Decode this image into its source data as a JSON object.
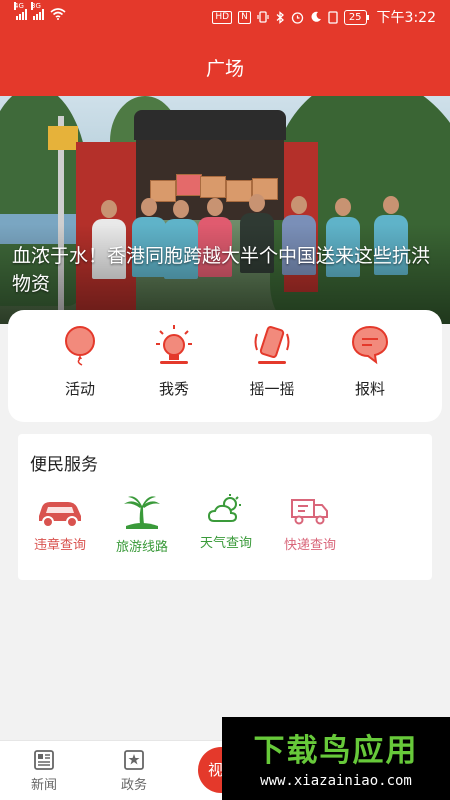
{
  "status_bar": {
    "signal_1_tag": "4G",
    "signal_2_tag": "3G",
    "hd_badge": "HD",
    "nfc_badge": "N",
    "battery": "25",
    "time": "下午3:22"
  },
  "header": {
    "title": "广场"
  },
  "banner": {
    "caption": "血浓于水！香港同胞跨越大半个中国送来这些抗洪物资"
  },
  "quick_actions": [
    {
      "label": "活动",
      "icon": "balloon-icon"
    },
    {
      "label": "我秀",
      "icon": "bulb-icon"
    },
    {
      "label": "摇一摇",
      "icon": "shake-phone-icon"
    },
    {
      "label": "报料",
      "icon": "chat-bubble-icon"
    }
  ],
  "services": {
    "title": "便民服务",
    "items": [
      {
        "label": "违章查询",
        "icon": "car-icon",
        "color": "#d9534f"
      },
      {
        "label": "旅游线路",
        "icon": "palm-tree-icon",
        "color": "#3a9a3a"
      },
      {
        "label": "天气查询",
        "icon": "weather-icon",
        "color": "#3a9a3a"
      },
      {
        "label": "快递查询",
        "icon": "truck-icon",
        "color": "#d9667a"
      }
    ]
  },
  "tab_bar": {
    "tabs": [
      {
        "label": "新闻",
        "icon": "newspaper-icon"
      },
      {
        "label": "政务",
        "icon": "government-icon"
      }
    ],
    "center_label": "视"
  },
  "watermark": {
    "title": "下载鸟应用",
    "url": "www.xiazainiao.com"
  },
  "colors": {
    "brand": "#e4392b",
    "background": "#f2f2f2"
  }
}
